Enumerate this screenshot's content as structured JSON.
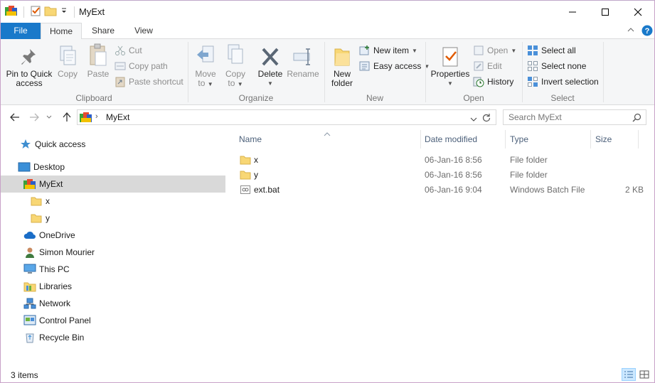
{
  "window": {
    "title": "MyExt"
  },
  "ribbon_tabs": {
    "file": "File",
    "home": "Home",
    "share": "Share",
    "view": "View"
  },
  "clipboard": {
    "label": "Clipboard",
    "pin": [
      "Pin to Quick",
      "access"
    ],
    "copy": "Copy",
    "paste": "Paste",
    "cut": "Cut",
    "copy_path": "Copy path",
    "paste_shortcut": "Paste shortcut"
  },
  "organize": {
    "label": "Organize",
    "move_to": [
      "Move",
      "to"
    ],
    "copy_to": [
      "Copy",
      "to"
    ],
    "delete": "Delete",
    "rename": "Rename"
  },
  "new": {
    "label": "New",
    "new_folder": [
      "New",
      "folder"
    ],
    "new_item": "New item",
    "easy_access": "Easy access"
  },
  "open": {
    "label": "Open",
    "properties": "Properties",
    "open": "Open",
    "edit": "Edit",
    "history": "History"
  },
  "select": {
    "label": "Select",
    "select_all": "Select all",
    "select_none": "Select none",
    "invert_selection": "Invert selection"
  },
  "address": {
    "crumb": "MyExt"
  },
  "search": {
    "placeholder": "Search MyExt"
  },
  "nav": [
    {
      "label": "Quick access"
    },
    {
      "label": "Desktop"
    },
    {
      "label": "MyExt"
    },
    {
      "label": "x"
    },
    {
      "label": "y"
    },
    {
      "label": "OneDrive"
    },
    {
      "label": "Simon Mourier"
    },
    {
      "label": "This PC"
    },
    {
      "label": "Libraries"
    },
    {
      "label": "Network"
    },
    {
      "label": "Control Panel"
    },
    {
      "label": "Recycle Bin"
    }
  ],
  "columns": {
    "name": "Name",
    "date": "Date modified",
    "type": "Type",
    "size": "Size"
  },
  "files": [
    {
      "name": "x",
      "date": "06-Jan-16 8:56",
      "type": "File folder",
      "size": ""
    },
    {
      "name": "y",
      "date": "06-Jan-16 8:56",
      "type": "File folder",
      "size": ""
    },
    {
      "name": "ext.bat",
      "date": "06-Jan-16 9:04",
      "type": "Windows Batch File",
      "size": "2 KB"
    }
  ],
  "status": {
    "count": "3 items"
  },
  "colors": {
    "accent": "#1979ca",
    "selection": "#d9d9d9",
    "header_text": "#4c607a"
  }
}
